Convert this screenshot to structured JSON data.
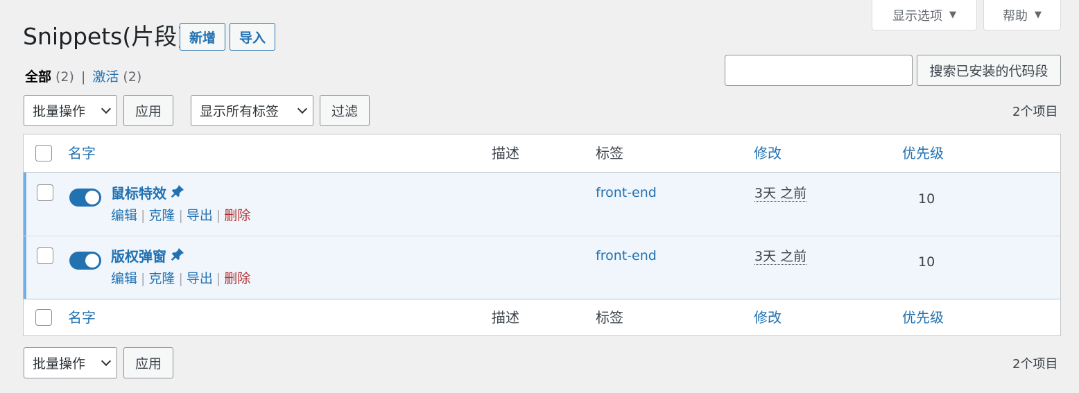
{
  "screen_meta": {
    "options_label": "显示选项",
    "help_label": "帮助"
  },
  "title": "Snippets(片段)",
  "add_new_label": "新增",
  "import_label": "导入",
  "views": {
    "all_label": "全部",
    "all_count": "(2)",
    "separator": "|",
    "active_label": "激活",
    "active_count": "(2)"
  },
  "search": {
    "value": "",
    "button_label": "搜索已安装的代码段"
  },
  "bulk_top": {
    "action_select": "批量操作",
    "apply_label": "应用",
    "tag_select": "显示所有标签",
    "filter_label": "过滤",
    "count": "2个项目"
  },
  "bulk_bottom": {
    "action_select": "批量操作",
    "apply_label": "应用",
    "count": "2个项目"
  },
  "columns": {
    "name": "名字",
    "desc": "描述",
    "tags": "标签",
    "modified": "修改",
    "priority": "优先级"
  },
  "rows": [
    {
      "name": "鼠标特效",
      "active": true,
      "tag": "front-end",
      "modified": "3天 之前",
      "priority": "10",
      "actions": {
        "edit": "编辑",
        "clone": "克隆",
        "export": "导出",
        "delete": "删除"
      }
    },
    {
      "name": "版权弹窗",
      "active": true,
      "tag": "front-end",
      "modified": "3天 之前",
      "priority": "10",
      "actions": {
        "edit": "编辑",
        "clone": "克隆",
        "export": "导出",
        "delete": "删除"
      }
    }
  ],
  "action_separator": "|",
  "colors": {
    "accent": "#2271b1",
    "delete": "#b32d2e",
    "row_highlight": "#f0f6fc"
  }
}
